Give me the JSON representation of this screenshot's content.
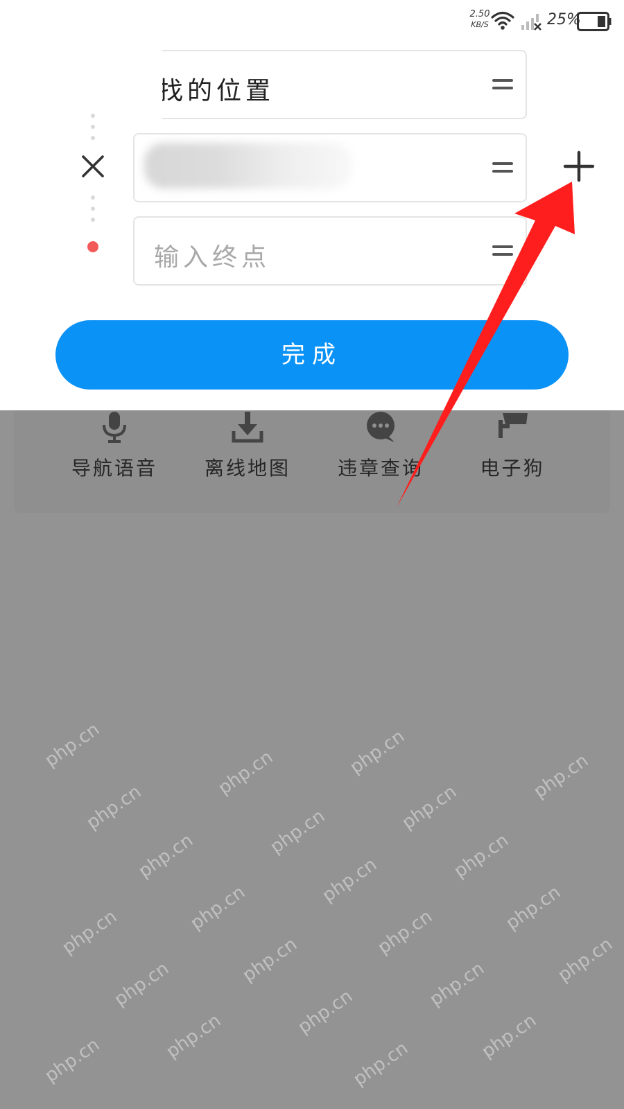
{
  "status_bar": {
    "net_speed": "2.50",
    "net_speed_unit": "KB/S",
    "battery_percent": "25%",
    "icons": [
      "wifi-icon",
      "cell-signal-off-icon",
      "battery-icon"
    ]
  },
  "route": {
    "start_value": "我的位置",
    "start_value_visible": "找的位置",
    "end_placeholder": "输入终点",
    "waypoint_value_blurred": true,
    "end_dot_color": "#f25a5a",
    "icons": [
      "close-icon",
      "add-icon",
      "drag-handle-icon"
    ]
  },
  "done_button": {
    "label": "完成",
    "color": "#0a92f6"
  },
  "tools": [
    {
      "label": "导航语音",
      "icon": "microphone-icon"
    },
    {
      "label": "离线地图",
      "icon": "download-icon"
    },
    {
      "label": "违章查询",
      "icon": "chat-bubble-icon"
    },
    {
      "label": "电子狗",
      "icon": "camera-icon"
    }
  ],
  "watermark_text": "php.cn",
  "annotation_color": "#ff1e1e"
}
